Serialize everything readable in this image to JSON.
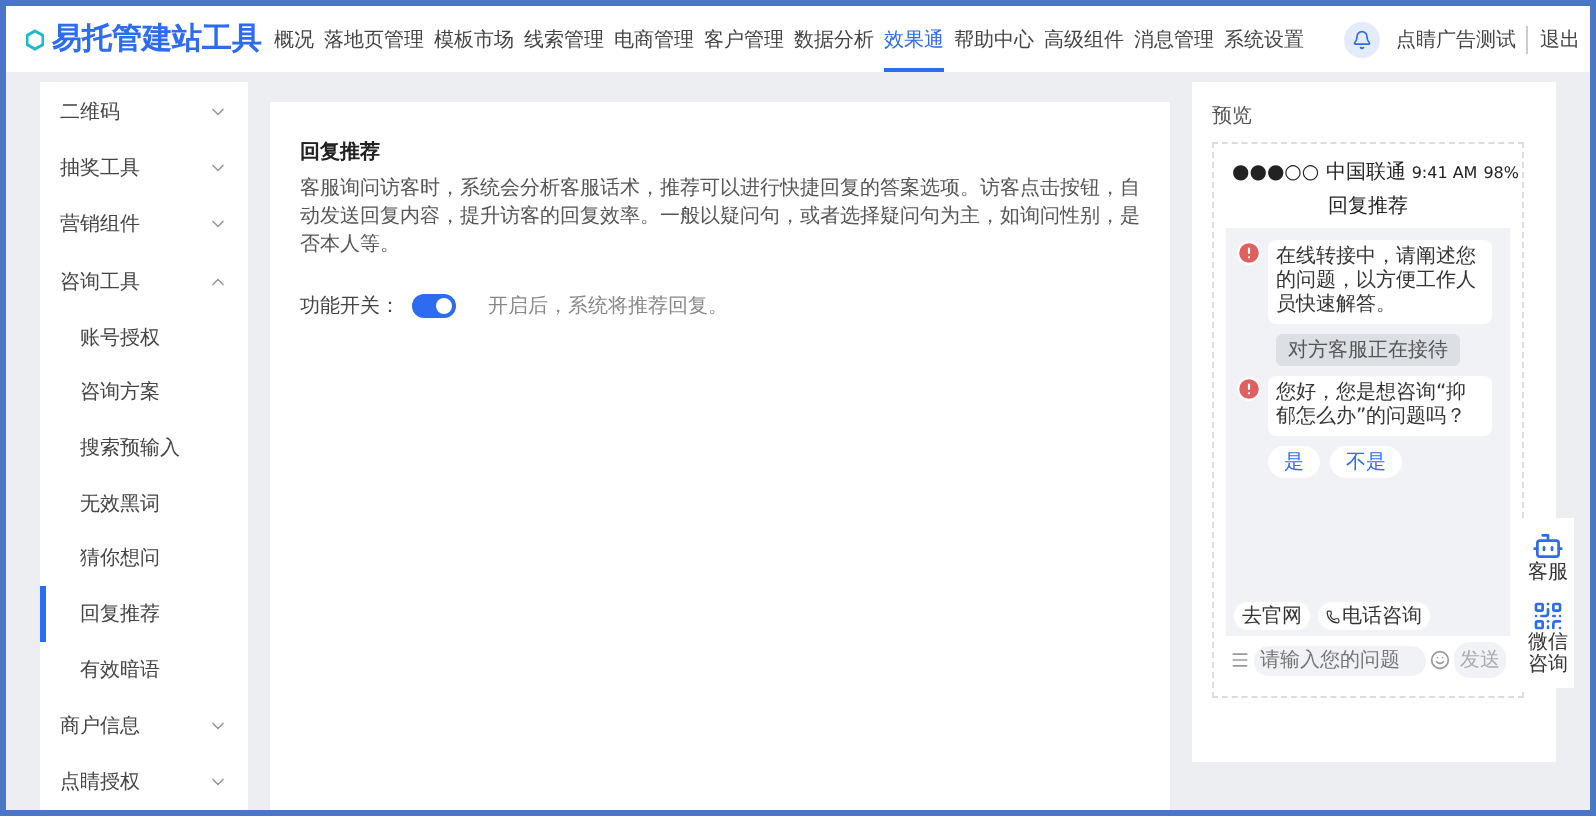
{
  "header": {
    "logo": "易托管建站工具",
    "nav": [
      {
        "label": "概况",
        "selected": false
      },
      {
        "label": "落地页管理",
        "selected": false
      },
      {
        "label": "模板市场",
        "selected": false
      },
      {
        "label": "线索管理",
        "selected": false
      },
      {
        "label": "电商管理",
        "selected": false
      },
      {
        "label": "客户管理",
        "selected": false
      },
      {
        "label": "数据分析",
        "selected": false
      },
      {
        "label": "效果通",
        "selected": true
      },
      {
        "label": "帮助中心",
        "selected": false
      },
      {
        "label": "高级组件",
        "selected": false
      },
      {
        "label": "消息管理",
        "selected": false
      },
      {
        "label": "系统设置",
        "selected": false
      }
    ],
    "user": "点睛广告测试",
    "logout": "退出"
  },
  "sidebar": {
    "groups": [
      {
        "label": "二维码",
        "expanded": false
      },
      {
        "label": "抽奖工具",
        "expanded": false
      },
      {
        "label": "营销组件",
        "expanded": false
      },
      {
        "label": "咨询工具",
        "expanded": true,
        "children": [
          {
            "label": "账号授权",
            "selected": false
          },
          {
            "label": "咨询方案",
            "selected": false
          },
          {
            "label": "搜索预输入",
            "selected": false
          },
          {
            "label": "无效黑词",
            "selected": false
          },
          {
            "label": "猜你想问",
            "selected": false
          },
          {
            "label": "回复推荐",
            "selected": true
          },
          {
            "label": "有效暗语",
            "selected": false
          }
        ]
      },
      {
        "label": "商户信息",
        "expanded": false
      },
      {
        "label": "点睛授权",
        "expanded": false
      }
    ]
  },
  "content": {
    "title": "回复推荐",
    "description": "客服询问访客时，系统会分析客服话术，推荐可以进行快捷回复的答案选项。访客点击按钮，自动发送回复内容，提升访客的回复效率。一般以疑问句，或者选择疑问句为主，如询问性别，是否本人等。",
    "switch": {
      "label": "功能开关：",
      "on": true,
      "hint": "开启后，系统将推荐回复。"
    }
  },
  "preview": {
    "label": "预览",
    "phone": {
      "carrier": "●●●○○ 中国联通",
      "time": "9:41 AM",
      "battery": "98%",
      "title": "回复推荐",
      "messages": [
        {
          "kind": "bot",
          "text": "在线转接中，请阐述您的问题，以方便工作人员快速解答。"
        },
        {
          "kind": "notice",
          "text": "对方客服正在接待"
        },
        {
          "kind": "bot",
          "text": "您好，您是想咨询“抑郁怎么办”的问题吗？",
          "options": [
            "是",
            "不是"
          ]
        }
      ],
      "shortcuts": [
        {
          "kind": "link",
          "label": "去官网"
        },
        {
          "kind": "phone",
          "label": "电话咨询"
        }
      ],
      "input": {
        "placeholder": "请输入您的问题"
      },
      "send": "发送"
    }
  },
  "float_widget": {
    "items": [
      {
        "kind": "robot",
        "label": "客服"
      },
      {
        "kind": "qrcode",
        "label": "微信咨询"
      }
    ]
  }
}
